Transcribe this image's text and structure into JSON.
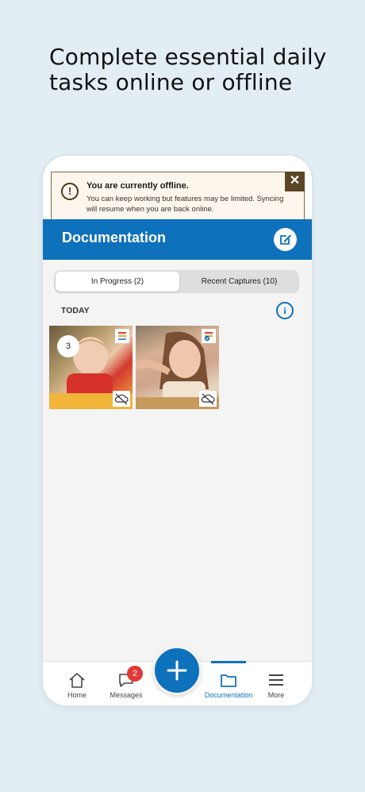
{
  "headline": {
    "line1": "Complete essential daily",
    "line2": "tasks online or offline"
  },
  "offline_banner": {
    "title": "You are currently offline.",
    "body": "You can keep working but features may be limited. Syncing will resume when you are back online.",
    "icon": "exclamation-icon",
    "close_icon": "close-icon"
  },
  "header": {
    "title": "Documentation",
    "edit_icon": "edit-icon"
  },
  "segments": {
    "in_progress": "In Progress  (2)",
    "recent_captures": "Recent Captures (10)",
    "selected": "In Progress"
  },
  "section": {
    "label": "TODAY",
    "info_icon": "info-icon"
  },
  "thumbnails": [
    {
      "count": "3",
      "tag_icon": "list-tag-icon",
      "sync_icon": "cloud-off-icon"
    },
    {
      "count": "",
      "tag_icon": "checked-list-icon",
      "sync_icon": "cloud-off-icon"
    }
  ],
  "tabbar": {
    "home": "Home",
    "messages": "Messages",
    "messages_badge": "2",
    "documentation": "Documentation",
    "more": "More",
    "active": "Documentation"
  },
  "colors": {
    "background": "#e2eef3",
    "brand_blue": "#0e71bc",
    "banner_bg": "#fdf6ec",
    "banner_accent": "#5a4626",
    "badge_red": "#e53935"
  }
}
